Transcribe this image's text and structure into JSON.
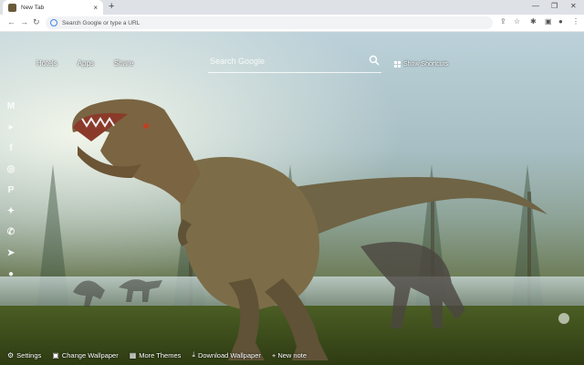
{
  "browser": {
    "tab_title": "New Tab",
    "new_tab": "+",
    "tab_close": "×",
    "omnibox_placeholder": "Search Google or type a URL"
  },
  "page": {
    "top_links": [
      "Hotels",
      "Apps",
      "Share"
    ],
    "search_placeholder": "Search Google",
    "show_shortcuts": "Show Shortcuts",
    "sidebar_icons": [
      "gmail-icon",
      "youtube-icon",
      "facebook-icon",
      "instagram-icon",
      "pinterest-icon",
      "twitter-icon",
      "whatsapp-icon",
      "telegram-icon",
      "reddit-icon"
    ],
    "bottom": {
      "settings": "Settings",
      "change_wallpaper": "Change Wallpaper",
      "more_themes": "More Themes",
      "download_wallpaper": "Download Wallpaper",
      "new_note": "+ New note"
    }
  }
}
